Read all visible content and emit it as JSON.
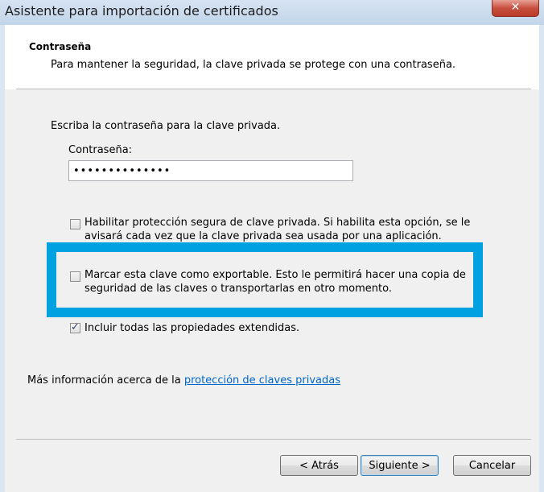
{
  "window": {
    "title": "Asistente para importación de certificados",
    "close_label": "✕"
  },
  "header": {
    "title": "Contraseña",
    "description": "Para mantener la seguridad, la clave privada se protege con una contraseña."
  },
  "body": {
    "instruction": "Escriba la contraseña para la clave privada.",
    "password_label": "Contraseña:",
    "password_value": "••••••••••••••"
  },
  "options": [
    {
      "line1": "Habilitar protección segura de clave privada. Si habilita esta opción, se le",
      "line2": "avisará cada vez que la clave privada sea usada por una aplicación.",
      "checked": false
    },
    {
      "line1": "Marcar esta clave como exportable. Esto le permitirá hacer una copia de",
      "line2": "seguridad de las claves o transportarlas en otro momento.",
      "checked": false
    },
    {
      "line1": "Incluir todas las propiedades extendidas.",
      "line2": "",
      "checked": true
    }
  ],
  "info": {
    "prefix": "Más información acerca de la ",
    "link": "protección de claves privadas"
  },
  "buttons": {
    "back": "< Atrás",
    "next": "Siguiente >",
    "cancel": "Cancelar"
  },
  "colors": {
    "highlight": "#00a1e0",
    "link": "#0066cc"
  }
}
